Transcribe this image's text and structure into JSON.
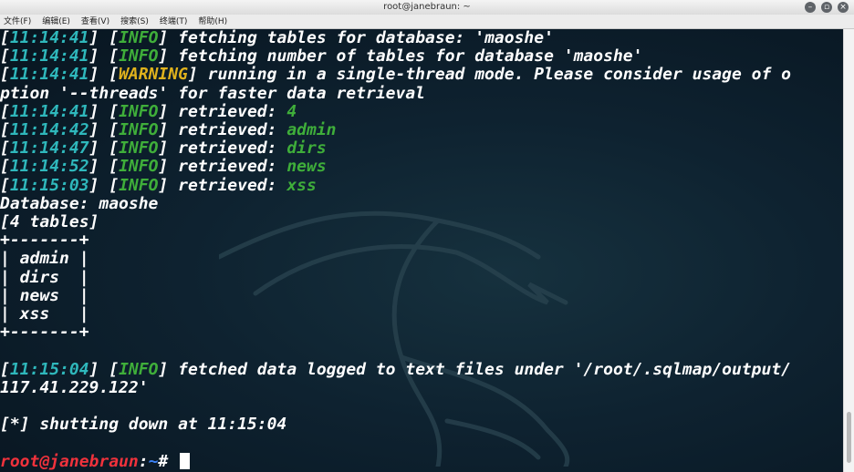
{
  "window": {
    "title": "root@janebraun: ~"
  },
  "menu": [
    "文件(F)",
    "编辑(E)",
    "查看(V)",
    "搜索(S)",
    "终端(T)",
    "帮助(H)"
  ],
  "terminal": {
    "l1": {
      "time": "11:14:41",
      "level": "INFO",
      "msg": "fetching tables for database: '",
      "val": "maoshe",
      "end": "'"
    },
    "l2": {
      "time": "11:14:41",
      "level": "INFO",
      "msg": "fetching number of tables for database '",
      "val": "maoshe",
      "end": "'"
    },
    "l3": {
      "time": "11:14:41",
      "level": "WARNING",
      "msg": "running in a single-thread mode. Please consider usage of o"
    },
    "l4": {
      "pre": "ption '",
      "val": "--threads",
      "post": "' for faster data retrieval"
    },
    "l5": {
      "time": "11:14:41",
      "level": "INFO",
      "msg": "retrieved: ",
      "val": "4"
    },
    "l6": {
      "time": "11:14:42",
      "level": "INFO",
      "msg": "retrieved: ",
      "val": "admin"
    },
    "l7": {
      "time": "11:14:47",
      "level": "INFO",
      "msg": "retrieved: ",
      "val": "dirs"
    },
    "l8": {
      "time": "11:14:52",
      "level": "INFO",
      "msg": "retrieved: ",
      "val": "news"
    },
    "l9": {
      "time": "11:15:03",
      "level": "INFO",
      "msg": "retrieved: ",
      "val": "xss"
    },
    "l10": "Database: maoshe",
    "l11": "[4 tables]",
    "l12": "+-------+",
    "l13": "| admin |",
    "l14": "| dirs  |",
    "l15": "| news  |",
    "l16": "| xss   |",
    "l17": "+-------+",
    "l19": {
      "time": "11:15:04",
      "level": "INFO",
      "msg": "fetched data logged to text files under '",
      "val": "/root/.sqlmap/output/"
    },
    "l20": {
      "val": "117.41.229.122",
      "end": "'"
    },
    "l22": "[*] shutting down at 11:15:04",
    "prompt": {
      "user": "root@janebraun",
      "sep": ":",
      "path": "~",
      "sym": "#"
    }
  }
}
